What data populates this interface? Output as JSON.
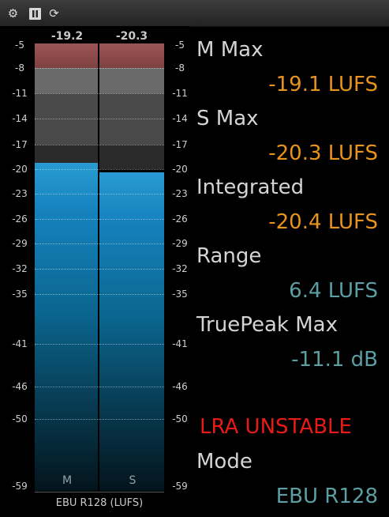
{
  "toolbar": {
    "icons": [
      "settings-icon",
      "pause-icon",
      "reset-icon"
    ]
  },
  "meter": {
    "peak_m": "-19.2",
    "peak_s": "-20.3",
    "scale": [
      "-5",
      "-8",
      "-11",
      "-14",
      "-17",
      "-20",
      "-23",
      "-26",
      "-29",
      "-32",
      "-35",
      "-41",
      "-46",
      "-50",
      "-59"
    ],
    "channel_m": "M",
    "channel_s": "S",
    "footer": "EBU R128 (LUFS)",
    "level_m": -19.2,
    "level_s": -20.3,
    "colors": {
      "red_zone": "#9c5556",
      "meter_blue": "#1582bd"
    }
  },
  "readouts": {
    "m_max_label": "M Max",
    "m_max_value": "-19.1 LUFS",
    "s_max_label": "S Max",
    "s_max_value": "-20.3 LUFS",
    "integrated_label": "Integrated",
    "integrated_value": "-20.4 LUFS",
    "range_label": "Range",
    "range_value": "6.4 LUFS",
    "truepeak_label": "TruePeak Max",
    "truepeak_value": "-11.1 dB",
    "warning": "LRA UNSTABLE",
    "mode_label": "Mode",
    "mode_value": "EBU R128",
    "colors": {
      "orange": "#e8941c",
      "teal": "#5b9ea4",
      "red": "#e81b17",
      "label": "#d4d4d4"
    }
  }
}
